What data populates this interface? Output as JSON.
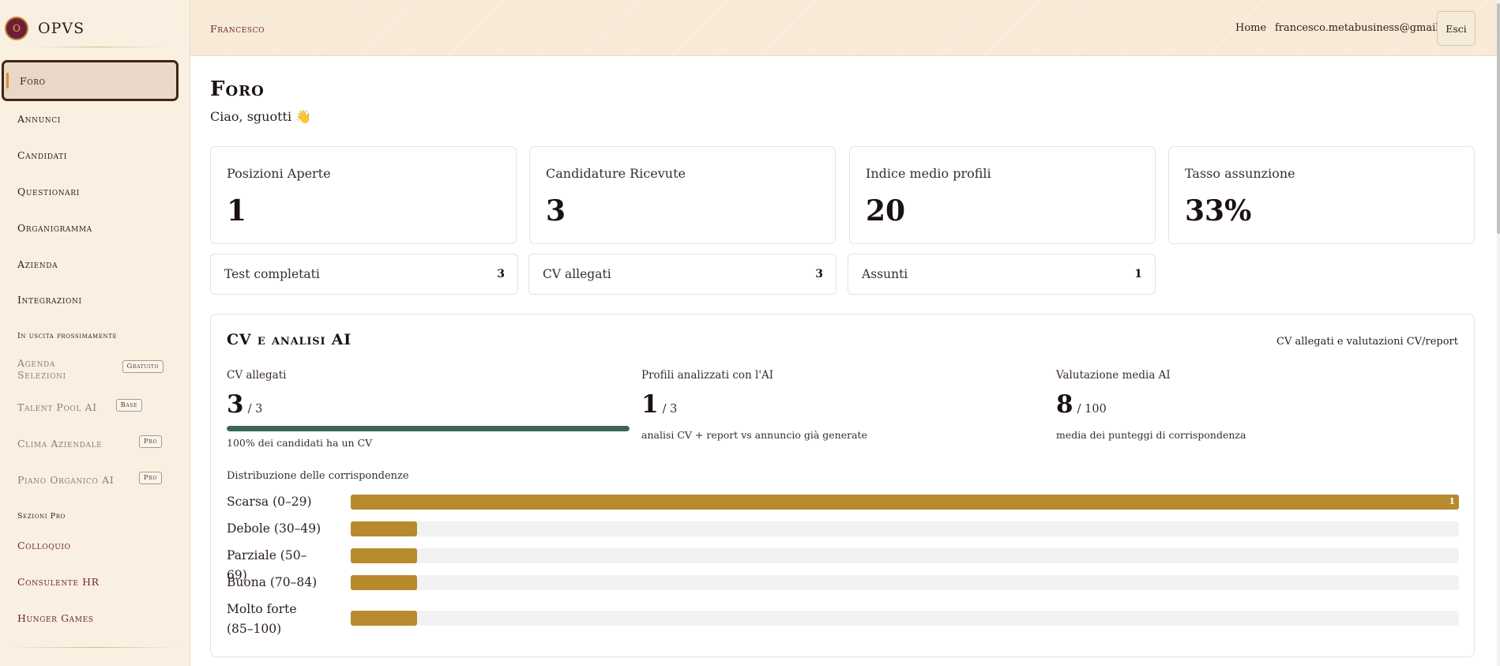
{
  "brand": {
    "logo_letter": "O",
    "name": "OPVS"
  },
  "sidebar": {
    "nav": [
      {
        "label": "Foro"
      },
      {
        "label": "Annunci"
      },
      {
        "label": "Candidati"
      },
      {
        "label": "Questionari"
      },
      {
        "label": "Organigramma"
      },
      {
        "label": "Azienda"
      },
      {
        "label": "Integrazioni"
      }
    ],
    "soon_section": "In uscita prossimamente",
    "soon_items": [
      {
        "label": "Agenda Selezioni",
        "badge": "Gratuito"
      },
      {
        "label": "Talent Pool AI",
        "badge": "Base"
      },
      {
        "label": "Clima Aziendale",
        "badge": "Pro"
      },
      {
        "label": "Piano Organico AI",
        "badge": "Pro"
      }
    ],
    "pro_section": "Sezioni Pro",
    "pro_items": [
      {
        "label": "Colloquio"
      },
      {
        "label": "Consulente HR"
      },
      {
        "label": "Hunger Games"
      }
    ]
  },
  "header": {
    "user": "Francesco",
    "home": "Home",
    "email": "francesco.metabusiness@gmail.com",
    "logout": "Esci"
  },
  "main": {
    "title": "Foro",
    "greeting": "Ciao, sguotti 👋",
    "stats": [
      {
        "label": "Posizioni Aperte",
        "value": "1"
      },
      {
        "label": "Candidature Ricevute",
        "value": "3"
      },
      {
        "label": "Indice medio profili",
        "value": "20"
      },
      {
        "label": "Tasso assunzione",
        "value": "33%"
      }
    ],
    "mini_stats": [
      {
        "label": "Test completati",
        "value": "3"
      },
      {
        "label": "CV allegati",
        "value": "3"
      },
      {
        "label": "Assunti",
        "value": "1"
      }
    ],
    "cv_panel": {
      "title": "CV e analisi AI",
      "link": "CV allegati e valutazioni CV/report",
      "metrics": [
        {
          "label": "CV allegati",
          "value": "3",
          "total": "/ 3",
          "progress": 1.0,
          "note": "100% dei candidati ha un CV"
        },
        {
          "label": "Profili analizzati con l'AI",
          "value": "1",
          "total": "/ 3",
          "note": "analisi CV + report vs annuncio già generate"
        },
        {
          "label": "Valutazione media AI",
          "value": "8",
          "total": "/ 100",
          "note": "media dei punteggi di corrispondenza"
        }
      ],
      "distribution_title": "Distribuzione delle corrispondenze",
      "distribution": [
        {
          "label": "Scarsa (0–29)",
          "count": 1,
          "count_label": "1"
        },
        {
          "label": "Debole (30–49)",
          "count": 0,
          "count_label": ""
        },
        {
          "label": "Parziale (50–69)",
          "count": 0,
          "count_label": ""
        },
        {
          "label": "Buona (70–84)",
          "count": 0,
          "count_label": ""
        },
        {
          "label": "Molto forte (85–100)",
          "count": 0,
          "count_label": ""
        }
      ]
    }
  },
  "colors": {
    "accent_gold": "#b88a2e",
    "accent_green": "#3b6555",
    "brand_wine": "#6e1f36"
  }
}
